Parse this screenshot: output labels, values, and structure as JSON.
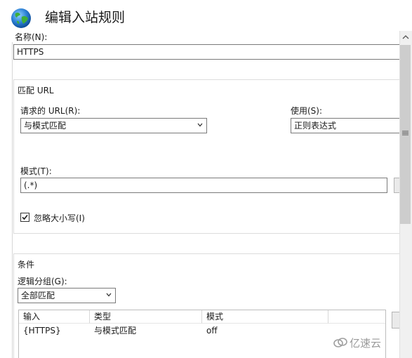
{
  "dialog": {
    "title": "编辑入站规则"
  },
  "name_field": {
    "label": "名称(N):",
    "value": "HTTPS"
  },
  "match_url": {
    "section_title": "匹配 URL",
    "requested_url_label": "请求的 URL(R):",
    "requested_url_value": "与模式匹配",
    "using_label": "使用(S):",
    "using_value": "正则表达式",
    "pattern_label": "模式(T):",
    "pattern_value": "(.*)",
    "ignore_case_label": "忽略大小写(I)",
    "ignore_case_checked": true
  },
  "conditions": {
    "section_title": "条件",
    "logical_group_label": "逻辑分组(G):",
    "logical_group_value": "全部匹配",
    "columns": [
      "输入",
      "类型",
      "模式"
    ],
    "rows": [
      {
        "input": "{HTTPS}",
        "type": "与模式匹配",
        "pattern": "off"
      }
    ]
  },
  "watermark": {
    "text": "亿速云"
  }
}
